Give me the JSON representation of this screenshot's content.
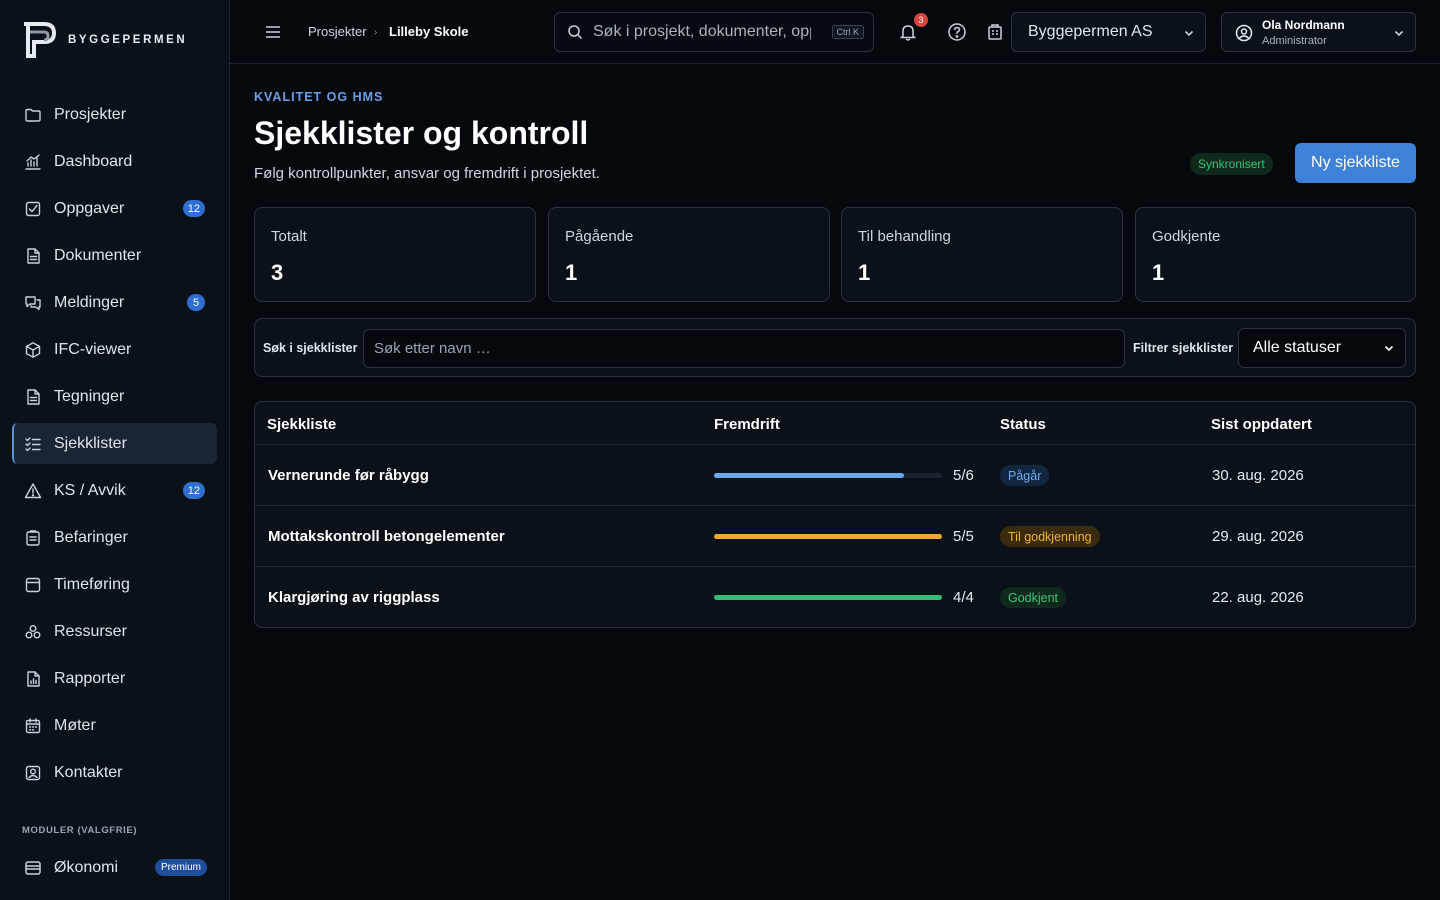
{
  "brand": {
    "name": "BYGGEPERMEN"
  },
  "sidebar": {
    "items": [
      {
        "label": "Prosjekter",
        "icon": "folder-icon"
      },
      {
        "label": "Dashboard",
        "icon": "chart-icon"
      },
      {
        "label": "Oppgaver",
        "icon": "checkbox-icon",
        "badge": "12"
      },
      {
        "label": "Dokumenter",
        "icon": "document-icon"
      },
      {
        "label": "Meldinger",
        "icon": "chat-icon",
        "badge": "5"
      },
      {
        "label": "IFC-viewer",
        "icon": "cube-icon"
      },
      {
        "label": "Tegninger",
        "icon": "drawing-icon"
      },
      {
        "label": "Sjekklister",
        "icon": "checklist-icon",
        "active": true
      },
      {
        "label": "KS / Avvik",
        "icon": "warning-icon",
        "badge": "12"
      },
      {
        "label": "Befaringer",
        "icon": "clipboard-icon"
      },
      {
        "label": "Timeføring",
        "icon": "clock-icon"
      },
      {
        "label": "Ressurser",
        "icon": "resources-icon"
      },
      {
        "label": "Rapporter",
        "icon": "report-icon"
      },
      {
        "label": "Møter",
        "icon": "calendar-icon"
      },
      {
        "label": "Kontakter",
        "icon": "contact-icon"
      }
    ],
    "section_label": "MODULER (VALGFRIE)",
    "extra": {
      "label": "Økonomi",
      "icon": "wallet-icon",
      "badge": "Premium"
    }
  },
  "topbar": {
    "breadcrumb": [
      "Prosjekter",
      "Lilleby Skole"
    ],
    "search_placeholder": "Søk i prosjekt, dokumenter, oppgaver…",
    "shortcut": "Ctrl K",
    "notification_count": "3",
    "company": "Byggepermen AS",
    "user": {
      "name": "Ola Nordmann",
      "role": "Administrator"
    }
  },
  "page": {
    "eyebrow": "KVALITET OG HMS",
    "title": "Sjekklister og kontroll",
    "subtitle": "Følg kontrollpunkter, ansvar og fremdrift i prosjektet.",
    "sync_status": "Synkronisert",
    "new_button": "Ny sjekkliste"
  },
  "stats": [
    {
      "label": "Totalt",
      "value": "3"
    },
    {
      "label": "Pågående",
      "value": "1"
    },
    {
      "label": "Til behandling",
      "value": "1"
    },
    {
      "label": "Godkjente",
      "value": "1"
    }
  ],
  "filter": {
    "search_label": "Søk i sjekklister",
    "search_placeholder": "Søk etter navn …",
    "status_label": "Filtrer sjekklister",
    "status_value": "Alle statuser"
  },
  "table": {
    "headers": [
      "Sjekkliste",
      "Fremdrift",
      "Status",
      "Sist oppdatert"
    ],
    "rows": [
      {
        "name": "Vernerunde før råbygg",
        "progress_text": "5/6",
        "progress": 0.833,
        "status": "Pågår",
        "status_color": "#6aa8f0",
        "status_bg": "#12263f",
        "bar_color": "#6aa8f0",
        "date": "30. aug. 2026"
      },
      {
        "name": "Mottakskontroll betongelementer",
        "progress_text": "5/5",
        "progress": 1.0,
        "status": "Til godkjenning",
        "status_color": "#f0b03a",
        "status_bg": "#3a2a0e",
        "bar_color": "#f0a830",
        "date": "29. aug. 2026"
      },
      {
        "name": "Klargjøring av riggplass",
        "progress_text": "4/4",
        "progress": 1.0,
        "status": "Godkjent",
        "status_color": "#3bc47a",
        "status_bg": "#0f2a1c",
        "bar_color": "#36c077",
        "date": "22. aug. 2026"
      }
    ]
  }
}
